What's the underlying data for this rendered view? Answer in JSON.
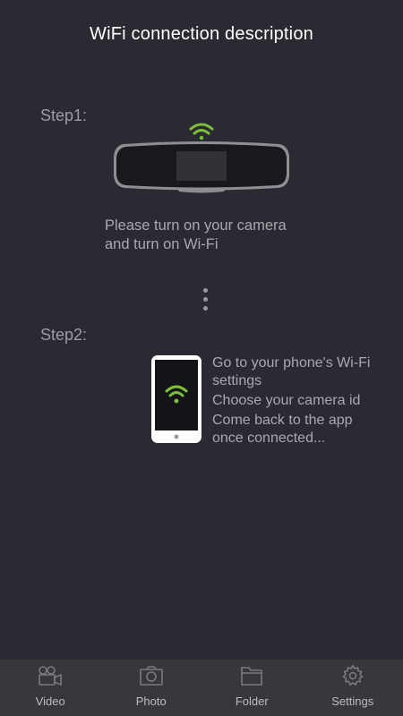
{
  "header": {
    "title": "WiFi connection description"
  },
  "steps": {
    "step1": {
      "label": "Step1:",
      "line1": "Please turn on your camera",
      "line2": "and turn on Wi-Fi"
    },
    "step2": {
      "label": "Step2:",
      "line1": "Go to your phone's Wi-Fi",
      "line2": "settings",
      "line3": "Choose your camera id",
      "line4": "Come back to the app",
      "line5": "once connected..."
    }
  },
  "colors": {
    "background": "#2b2a32",
    "accent_wifi": "#7dc13a",
    "bottom_bar": "#38373d"
  },
  "bottom_nav": {
    "items": [
      {
        "label": "Video",
        "icon": "video-camera-icon"
      },
      {
        "label": "Photo",
        "icon": "camera-icon"
      },
      {
        "label": "Folder",
        "icon": "folder-icon"
      },
      {
        "label": "Settings",
        "icon": "gear-icon"
      }
    ]
  }
}
